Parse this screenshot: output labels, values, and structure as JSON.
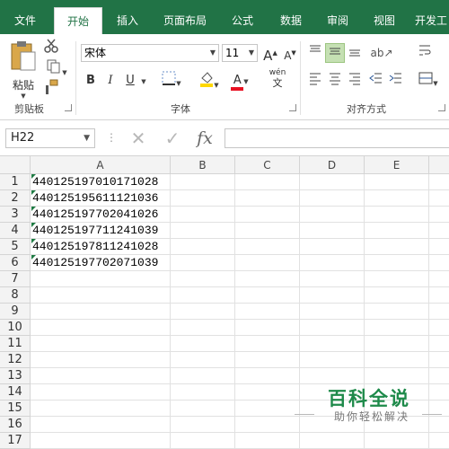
{
  "colors": {
    "brand": "#217346",
    "accent_green": "#1e8a4a",
    "selected_align": "#c5e0b3"
  },
  "tabs": [
    {
      "label": "文件"
    },
    {
      "label": "开始"
    },
    {
      "label": "插入"
    },
    {
      "label": "页面布局"
    },
    {
      "label": "公式"
    },
    {
      "label": "数据"
    },
    {
      "label": "审阅"
    },
    {
      "label": "视图"
    },
    {
      "label": "开发工"
    }
  ],
  "ribbon": {
    "clipboard": {
      "paste_label": "粘贴",
      "group_label": "剪贴板"
    },
    "font": {
      "name": "宋体",
      "size": "11",
      "bold": "B",
      "italic": "I",
      "underline": "U",
      "grow": "A",
      "shrink": "A",
      "color_letter": "A",
      "phonetic": "wén",
      "phonetic_sub": "文",
      "group_label": "字体"
    },
    "alignment": {
      "group_label": "对齐方式"
    }
  },
  "formula_bar": {
    "name_box": "H22",
    "cancel": "✕",
    "enter": "✓",
    "fx": "fx",
    "value": ""
  },
  "grid": {
    "columns": [
      "A",
      "B",
      "C",
      "D",
      "E"
    ],
    "rows": [
      "1",
      "2",
      "3",
      "4",
      "5",
      "6",
      "7",
      "8",
      "9",
      "10",
      "11",
      "12",
      "13",
      "14",
      "15",
      "16",
      "17"
    ],
    "cells_A": [
      "440125197010171028",
      "440125195611121036",
      "440125197702041026",
      "440125197711241039",
      "440125197811241028",
      "440125197702071039"
    ]
  },
  "watermark": {
    "title": "百科全说",
    "subtitle": "助你轻松解决"
  }
}
